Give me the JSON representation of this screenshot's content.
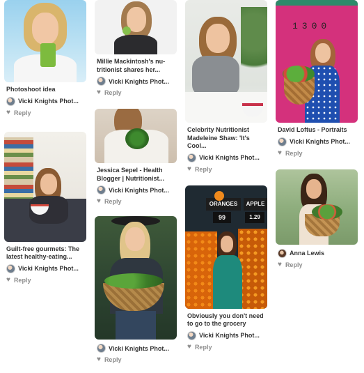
{
  "reply_label": "Reply",
  "columns": [
    [
      {
        "title": "Photoshoot idea",
        "owner": "Vicki Knights Phot..."
      },
      {
        "title": "Guilt-free gourmets: The latest healthy-eating...",
        "owner": "Vicki Knights Phot..."
      }
    ],
    [
      {
        "title": "Millie Mackintosh's nu-tritionist shares her...",
        "owner": "Vicki Knights Phot..."
      },
      {
        "title": "Jessica Sepel - Health Blogger | Nutritionist...",
        "owner": "Vicki Knights Phot..."
      },
      {
        "title": "",
        "owner": "Vicki Knights Phot..."
      }
    ],
    [
      {
        "title": "Celebrity Nutritionist Madeleine Shaw: 'It's Cool...",
        "owner": "Vicki Knights Phot..."
      },
      {
        "title": "Obviously you don't need to go to the grocery",
        "owner": "Vicki Knights Phot...",
        "signs": [
          "ORANGES",
          "APPLE",
          "99",
          "1.29"
        ]
      }
    ],
    [
      {
        "title": "David Loftus - Portraits",
        "owner": "Vicki Knights Phot...",
        "door_number": "1300"
      },
      {
        "title": "",
        "owner": "Anna Lewis"
      }
    ]
  ]
}
